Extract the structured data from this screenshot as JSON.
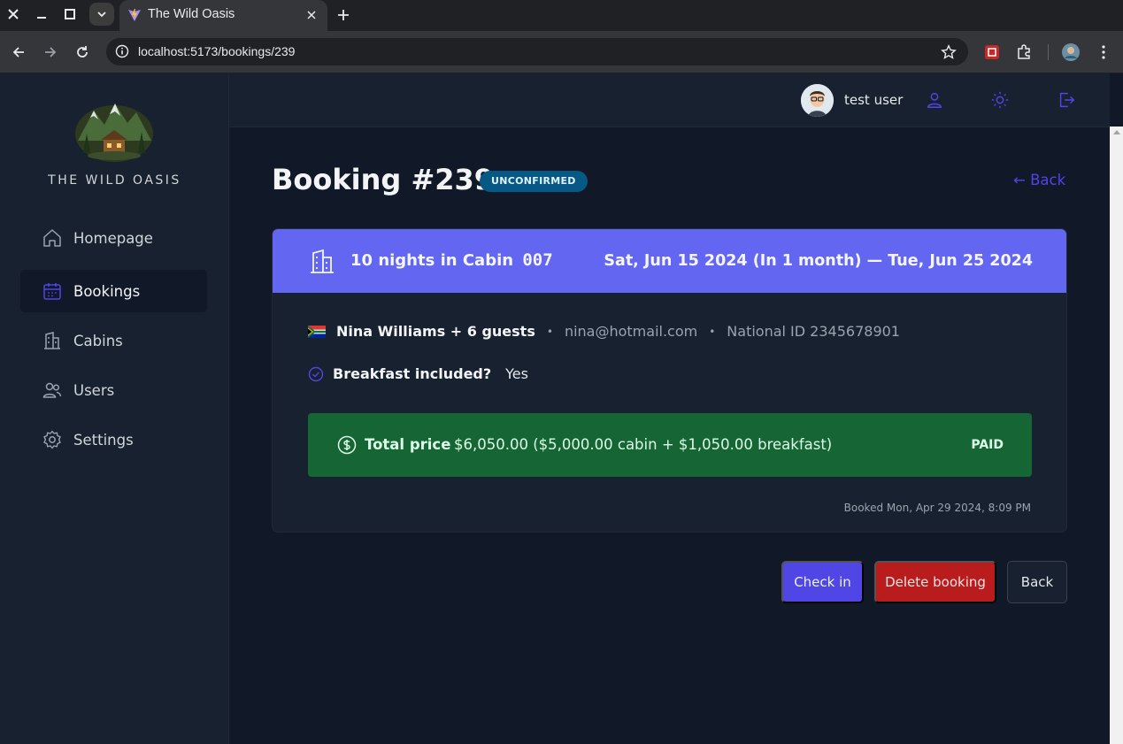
{
  "browser": {
    "tab_title": "The Wild Oasis",
    "url": "localhost:5173/bookings/239"
  },
  "sidebar": {
    "brand": "THE WILD OASIS",
    "items": [
      {
        "label": "Homepage",
        "icon": "home-icon"
      },
      {
        "label": "Bookings",
        "icon": "calendar-icon",
        "active": true
      },
      {
        "label": "Cabins",
        "icon": "building-icon"
      },
      {
        "label": "Users",
        "icon": "users-icon"
      },
      {
        "label": "Settings",
        "icon": "gear-icon"
      }
    ]
  },
  "header": {
    "username": "test user"
  },
  "booking": {
    "title": "Booking #239",
    "status": "UNCONFIRMED",
    "back_link": "← Back",
    "nights_text": "10 nights in Cabin",
    "cabin_name": "007",
    "dates": "Sat, Jun 15 2024 (In 1 month) — Tue, Jun 25 2024",
    "guest_name": "Nina Williams + 6 guests",
    "email": "nina@hotmail.com",
    "national_id": "National ID 2345678901",
    "breakfast_label": "Breakfast included?",
    "breakfast_value": "Yes",
    "price_label": "Total price",
    "price_value": "$6,050.00 ($5,000.00 cabin + $1,050.00 breakfast)",
    "paid_status": "PAID",
    "booked_at": "Booked Mon, Apr 29 2024, 8:09 PM"
  },
  "actions": {
    "checkin": "Check in",
    "delete": "Delete booking",
    "back": "Back"
  },
  "colors": {
    "accent": "#4f46e5",
    "card_header": "#6366f1",
    "paid_bg": "#166534",
    "danger": "#b91c1c",
    "badge": "#075985"
  }
}
